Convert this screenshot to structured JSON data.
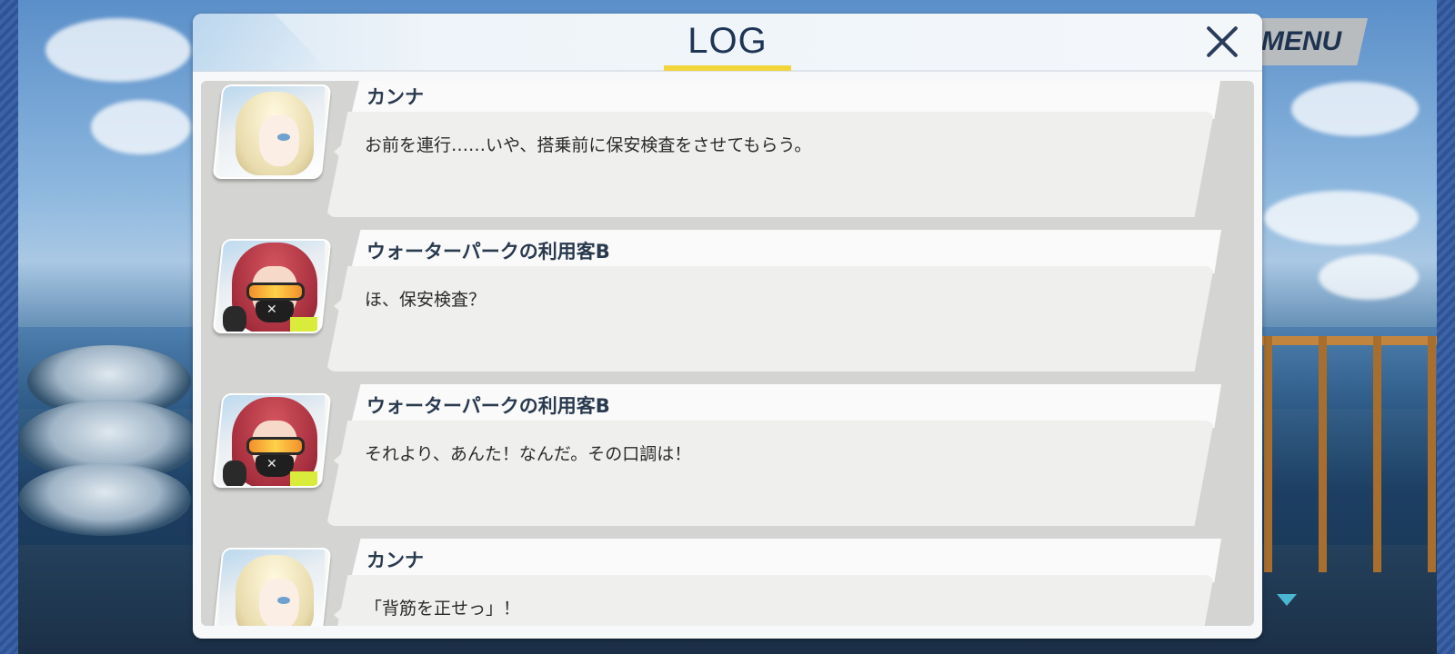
{
  "menu": {
    "label": "MENU"
  },
  "log": {
    "title": "LOG",
    "entries": [
      {
        "speaker": "カンナ",
        "text": "お前を連行……いや、搭乗前に保安検査をさせてもらう。",
        "portrait": "kanna-portrait"
      },
      {
        "speaker": "ウォーターパークの利用客B",
        "text": "ほ、保安検査？",
        "portrait": "waterpark-guest-b-portrait"
      },
      {
        "speaker": "ウォーターパークの利用客B",
        "text": "それより、あんた！なんだ。その口調は！",
        "portrait": "waterpark-guest-b-portrait"
      },
      {
        "speaker": "カンナ",
        "text": "「背筋を正せっ」！",
        "portrait": "kanna-portrait"
      }
    ]
  },
  "colors": {
    "accent_underline": "#f2d53a",
    "title_text": "#1f3555",
    "indicator": "#4ab6d1"
  },
  "icons": {
    "close": "close-icon",
    "more": "chevron-down-icon"
  }
}
